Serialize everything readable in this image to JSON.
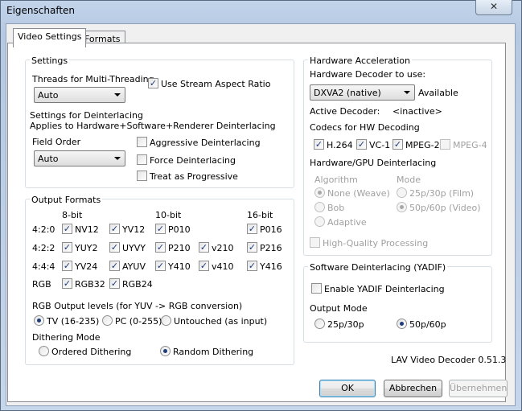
{
  "window": {
    "title": "Eigenschaften",
    "close_glyph": "✕"
  },
  "tabs": [
    {
      "label": "Video Settings"
    },
    {
      "label": "Formats"
    }
  ],
  "settings": {
    "title": "Settings",
    "threads_label": "Threads for Multi-Threading",
    "threads_value": "Auto",
    "stream_aspect_label": "Use Stream Aspect Ratio",
    "deint_title": "Settings for Deinterlacing",
    "deint_note": "Applies to Hardware+Software+Renderer Deinterlacing",
    "field_order_label": "Field Order",
    "field_order_value": "Auto",
    "aggressive_label": "Aggressive Deinterlacing",
    "force_label": "Force Deinterlacing",
    "progressive_label": "Treat as Progressive"
  },
  "output": {
    "title": "Output Formats",
    "col_8bit": "8-bit",
    "col_10bit": "10-bit",
    "col_16bit": "16-bit",
    "row_420": "4:2:0",
    "row_422": "4:2:2",
    "row_444": "4:4:4",
    "row_rgb": "RGB",
    "nv12": "NV12",
    "yv12": "YV12",
    "p010": "P010",
    "p016": "P016",
    "yuy2": "YUY2",
    "uyvy": "UYVY",
    "p210": "P210",
    "v210": "v210",
    "p216": "P216",
    "yv24": "YV24",
    "ayuv": "AYUV",
    "y410": "Y410",
    "v410": "v410",
    "y416": "Y416",
    "rgb32": "RGB32",
    "rgb24": "RGB24",
    "levels_label": "RGB Output levels (for YUV -> RGB conversion)",
    "tv_label": "TV (16-235)",
    "pc_label": "PC (0-255)",
    "untouched_label": "Untouched (as input)",
    "dither_label": "Dithering Mode",
    "ordered_label": "Ordered Dithering",
    "random_label": "Random Dithering"
  },
  "hw": {
    "title": "Hardware Acceleration",
    "decoder_label": "Hardware Decoder to use:",
    "decoder_value": "DXVA2 (native)",
    "available": "Available",
    "active_label": "Active Decoder:",
    "active_value": "<inactive>",
    "codecs_label": "Codecs for HW Decoding",
    "h264": "H.264",
    "vc1": "VC-1",
    "mpeg2": "MPEG-2",
    "mpeg4": "MPEG-4",
    "deint_label": "Hardware/GPU Deinterlacing",
    "algorithm_label": "Algorithm",
    "mode_label": "Mode",
    "weave": "None (Weave)",
    "bob": "Bob",
    "adaptive": "Adaptive",
    "film": "25p/30p (Film)",
    "video": "50p/60p (Video)",
    "hq_label": "High-Quality Processing"
  },
  "yadif": {
    "title": "Software Deinterlacing (YADIF)",
    "enable_label": "Enable YADIF Deinterlacing",
    "mode_label": "Output Mode",
    "opt_25": "25p/30p",
    "opt_50": "50p/60p"
  },
  "version": "LAV Video Decoder 0.51.3",
  "buttons": {
    "ok": "OK",
    "cancel": "Abbrechen",
    "apply": "Übernehmen"
  },
  "check_glyph": "✓"
}
